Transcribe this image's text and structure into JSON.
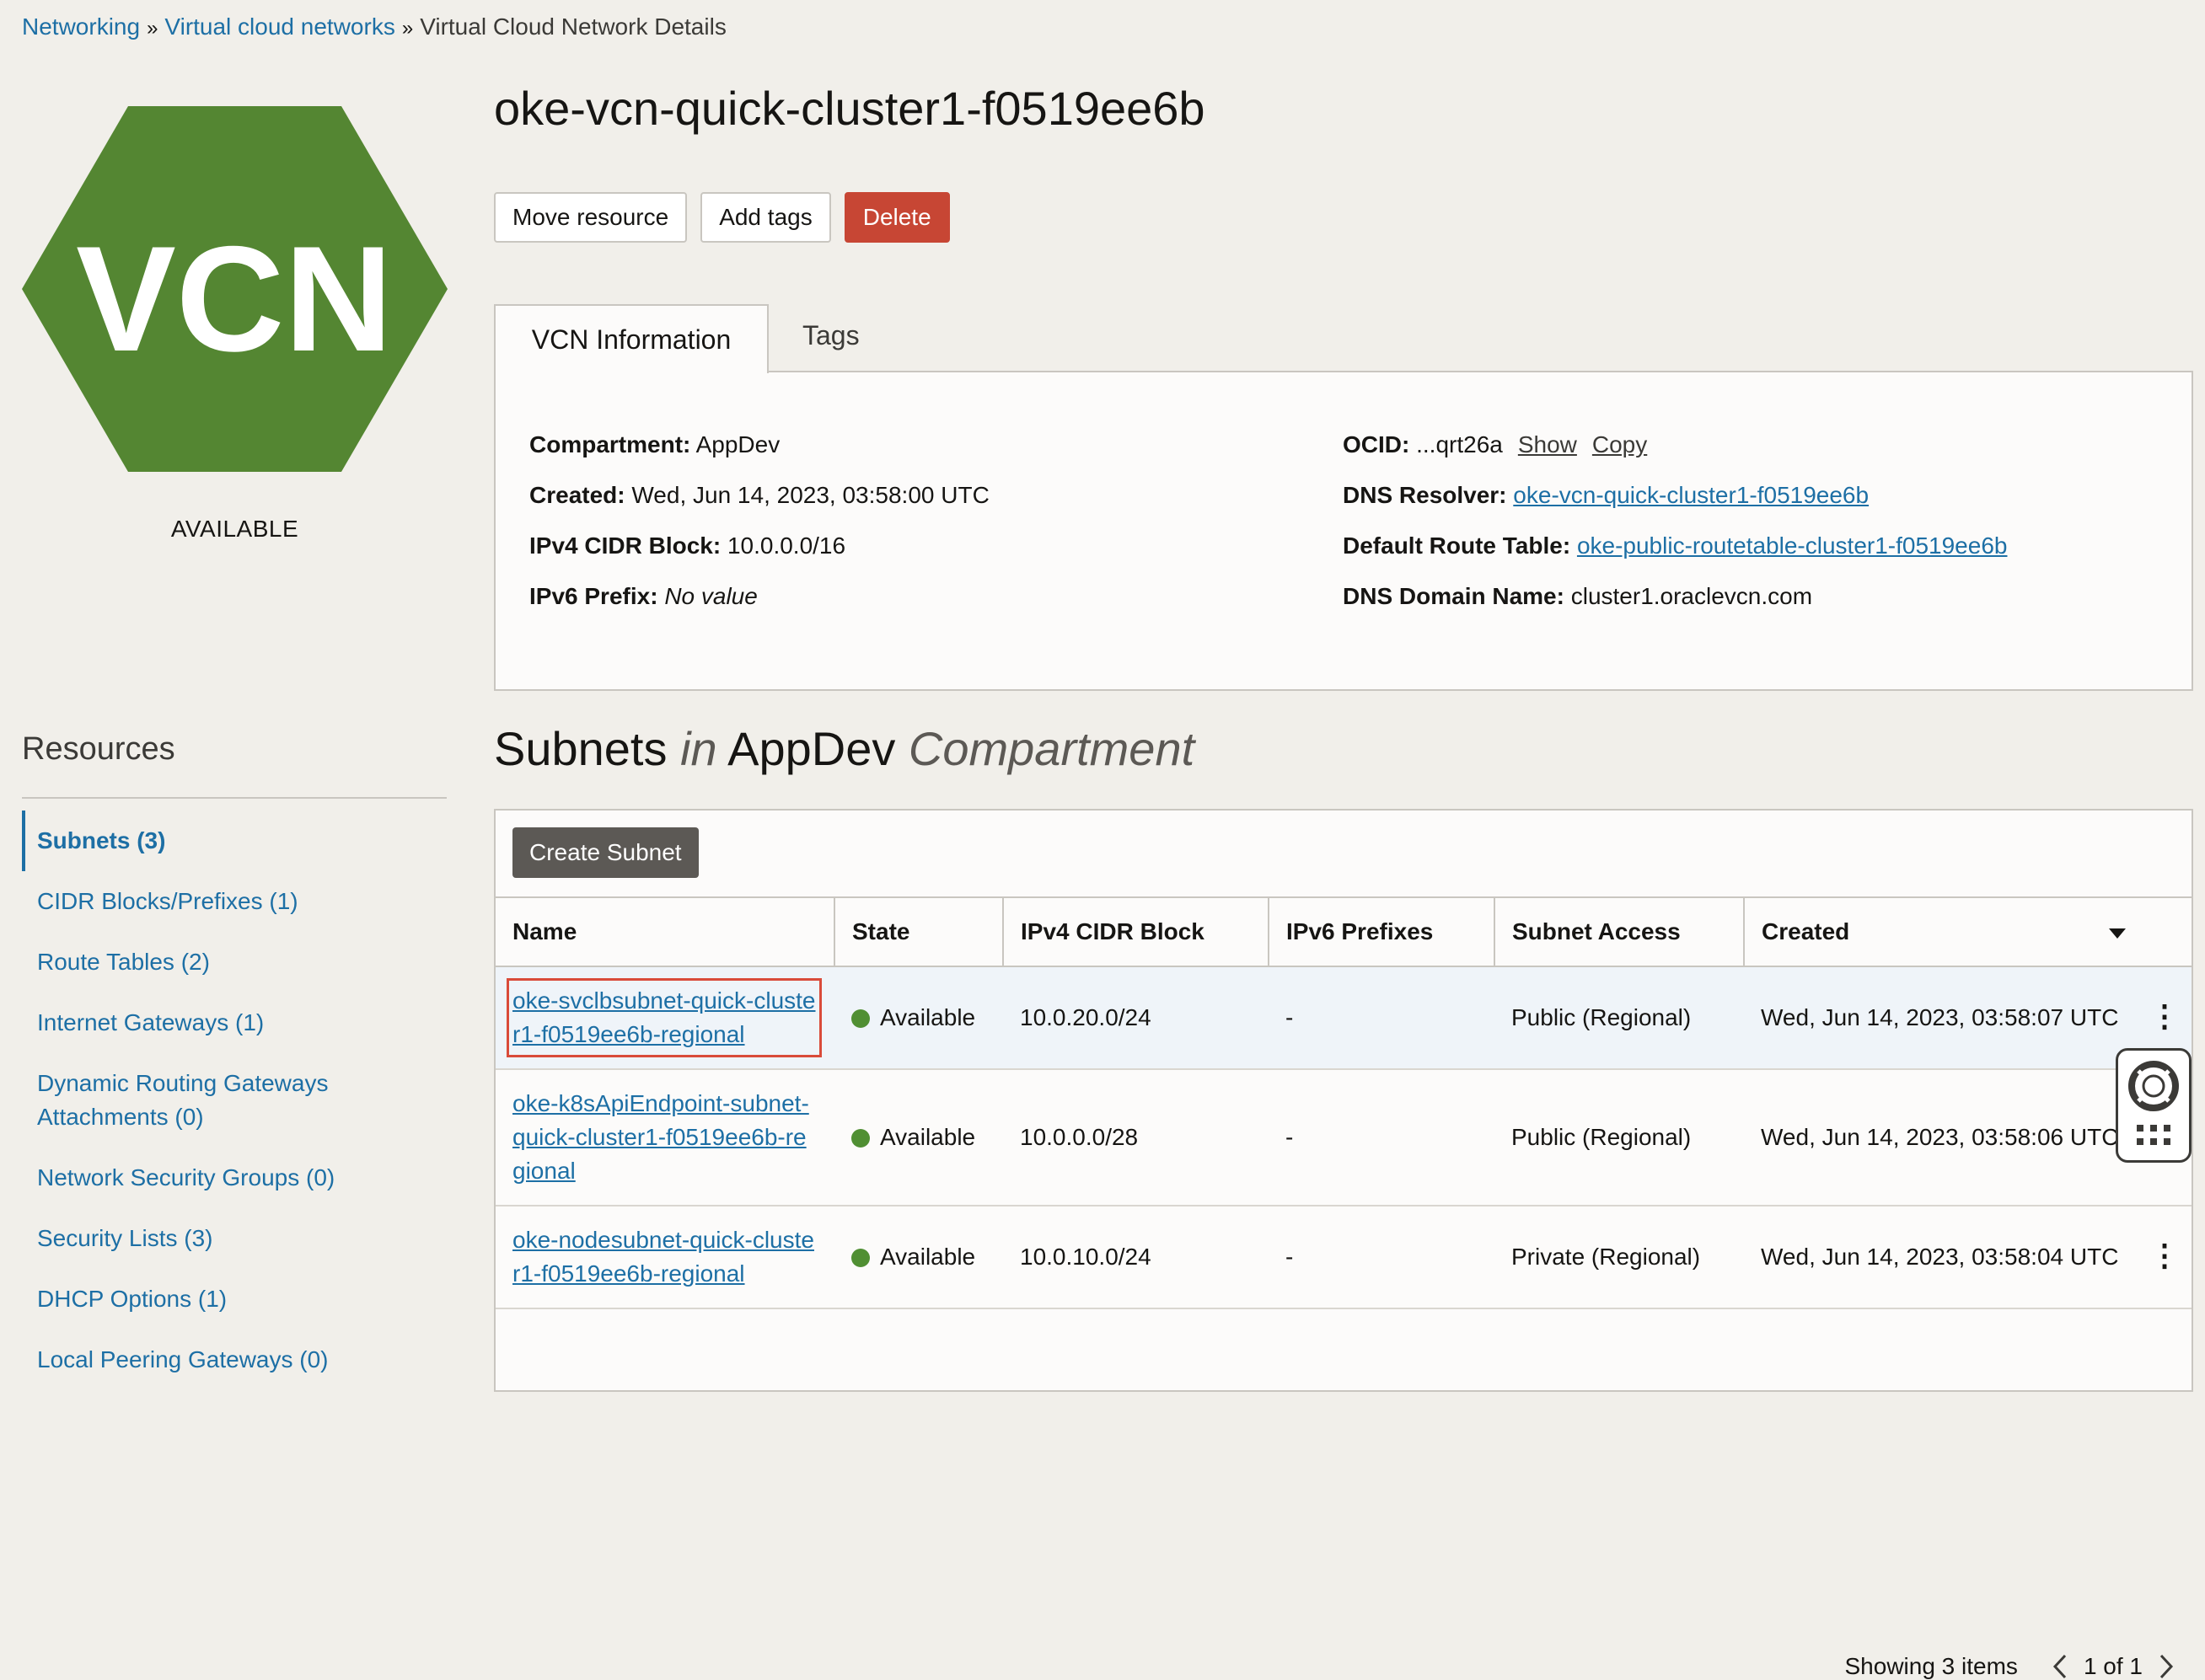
{
  "breadcrumb": {
    "items": [
      "Networking",
      "Virtual cloud networks"
    ],
    "current": "Virtual Cloud Network Details",
    "separator": "»"
  },
  "resource_icon": {
    "label": "VCN",
    "color": "#548632",
    "status": "AVAILABLE"
  },
  "header": {
    "title": "oke-vcn-quick-cluster1-f0519ee6b",
    "buttons": {
      "move": "Move resource",
      "tags": "Add tags",
      "delete": "Delete"
    }
  },
  "tabs": {
    "info": "VCN Information",
    "tags": "Tags"
  },
  "info": {
    "compartment_label": "Compartment:",
    "compartment_value": "AppDev",
    "created_label": "Created:",
    "created_value": "Wed, Jun 14, 2023, 03:58:00 UTC",
    "ipv4_label": "IPv4 CIDR Block:",
    "ipv4_value": "10.0.0.0/16",
    "ipv6_label": "IPv6 Prefix:",
    "ipv6_value": "No value",
    "ocid_label": "OCID:",
    "ocid_value": "...qrt26a",
    "ocid_show": "Show",
    "ocid_copy": "Copy",
    "dns_resolver_label": "DNS Resolver:",
    "dns_resolver_value": "oke-vcn-quick-cluster1-f0519ee6b",
    "route_table_label": "Default Route Table:",
    "route_table_value": "oke-public-routetable-cluster1-f0519ee6b",
    "dns_domain_label": "DNS Domain Name:",
    "dns_domain_value": "cluster1.oraclevcn.com"
  },
  "resources": {
    "heading": "Resources",
    "items": [
      "Subnets (3)",
      "CIDR Blocks/Prefixes (1)",
      "Route Tables (2)",
      "Internet Gateways (1)",
      "Dynamic Routing Gateways Attachments (0)",
      "Network Security Groups (0)",
      "Security Lists (3)",
      "DHCP Options (1)",
      "Local Peering Gateways (0)"
    ]
  },
  "subnets": {
    "title_main": "Subnets",
    "title_in": "in",
    "title_compartment": "AppDev",
    "title_suffix": "Compartment",
    "create_button": "Create Subnet",
    "columns": [
      "Name",
      "State",
      "IPv4 CIDR Block",
      "IPv6 Prefixes",
      "Subnet Access",
      "Created"
    ],
    "rows": [
      {
        "name": "oke-svclbsubnet-quick-cluster1-f0519ee6b-regional",
        "state": "Available",
        "ipv4": "10.0.20.0/24",
        "ipv6": "-",
        "access": "Public (Regional)",
        "created": "Wed, Jun 14, 2023, 03:58:07 UTC"
      },
      {
        "name": "oke-k8sApiEndpoint-subnet-quick-cluster1-f0519ee6b-regional",
        "state": "Available",
        "ipv4": "10.0.0.0/28",
        "ipv6": "-",
        "access": "Public (Regional)",
        "created": "Wed, Jun 14, 2023, 03:58:06 UTC"
      },
      {
        "name": "oke-nodesubnet-quick-cluster1-f0519ee6b-regional",
        "state": "Available",
        "ipv4": "10.0.10.0/24",
        "ipv6": "-",
        "access": "Private (Regional)",
        "created": "Wed, Jun 14, 2023, 03:58:04 UTC"
      }
    ],
    "footer": {
      "showing": "Showing 3 items",
      "page": "1 of 1"
    }
  },
  "colors": {
    "accent": "#1d6fa5",
    "danger": "#c74634",
    "status_available": "#508f33",
    "highlight": "#d94b3a"
  },
  "icons": [
    "vcn-hexagon-icon",
    "kebab-menu-icon",
    "sort-caret-icon",
    "chevron-left-icon",
    "chevron-right-icon",
    "lifebuoy-icon",
    "grid-icon"
  ]
}
